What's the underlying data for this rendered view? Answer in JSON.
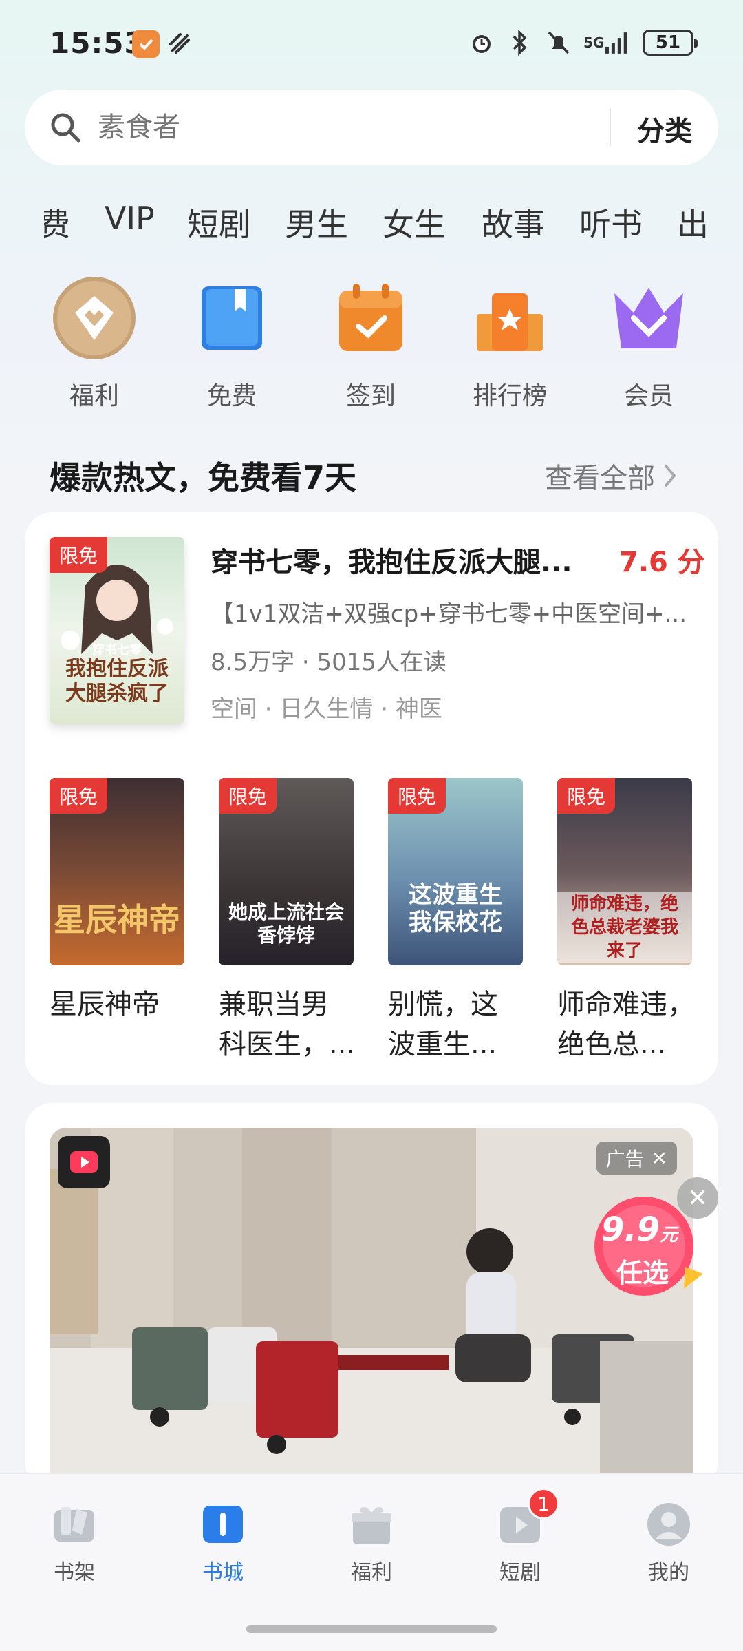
{
  "status_bar": {
    "time": "15:53",
    "network": "5G",
    "battery": "51"
  },
  "search": {
    "placeholder": "素食者",
    "category_label": "分类"
  },
  "tabs": [
    "费",
    "VIP",
    "短剧",
    "男生",
    "女生",
    "故事",
    "听书",
    "出"
  ],
  "entries": [
    {
      "label": "福利",
      "icon": "diamond-crown-icon"
    },
    {
      "label": "免费",
      "icon": "open-book-icon"
    },
    {
      "label": "签到",
      "icon": "calendar-check-icon"
    },
    {
      "label": "排行榜",
      "icon": "ranking-podium-icon"
    },
    {
      "label": "会员",
      "icon": "vip-crown-icon"
    }
  ],
  "section": {
    "title": "爆款热文，免费看7天",
    "view_all": "查看全部"
  },
  "featured": {
    "badge": "限免",
    "cover_title": "我抱住反派大腿杀疯了",
    "cover_subtitle": "穿书七零",
    "title": "穿书七零，我抱住反派大腿...",
    "score": "7.6 分",
    "description": "【1v1双洁+双强cp+穿书七零+中医空间+...",
    "meta": "8.5万字 · 5015人在读",
    "tags": "空间 · 日久生情 · 神医"
  },
  "books": [
    {
      "badge": "限免",
      "cover_title": "星辰神帝",
      "title_line1": "星辰神帝",
      "title_line2": ""
    },
    {
      "badge": "限免",
      "cover_title": "她成上流社会香饽饽",
      "title_line1": "兼职当男",
      "title_line2": "科医生，..."
    },
    {
      "badge": "限免",
      "cover_title": "这波重生我保校花",
      "title_line1": "别慌，这",
      "title_line2": "波重生..."
    },
    {
      "badge": "限免",
      "cover_title": "师命难违，绝色总裁老婆我来了",
      "title_line1": "师命难违，",
      "title_line2": "绝色总..."
    }
  ],
  "ad": {
    "label": "广告",
    "promo_price": "9.9",
    "promo_unit": "元",
    "promo_text": "任选"
  },
  "bottom_nav": [
    {
      "label": "书架",
      "icon": "bookshelf-icon",
      "active": false
    },
    {
      "label": "书城",
      "icon": "bookstore-icon",
      "active": true
    },
    {
      "label": "福利",
      "icon": "gift-icon",
      "active": false
    },
    {
      "label": "短剧",
      "icon": "short-drama-icon",
      "active": false,
      "badge": "1"
    },
    {
      "label": "我的",
      "icon": "profile-icon",
      "active": false
    }
  ],
  "colors": {
    "accent": "#2b7de9",
    "badge": "#e53935",
    "score": "#e53935"
  }
}
